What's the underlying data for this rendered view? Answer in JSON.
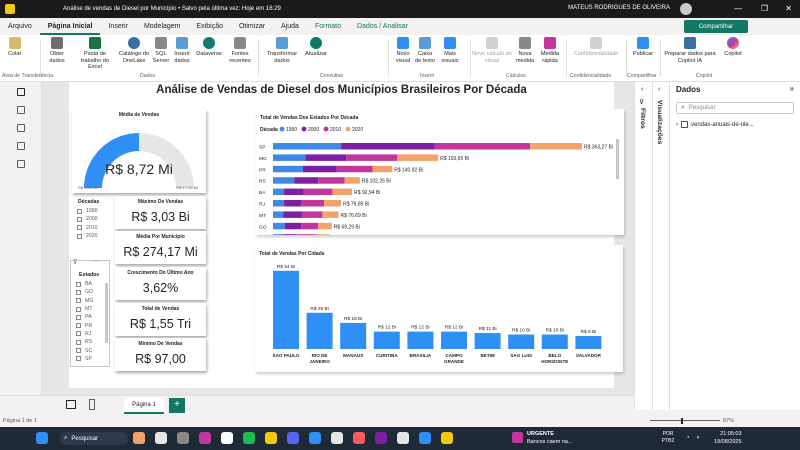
{
  "window": {
    "title": "Análise de vendas de Diesel por Município • Salvo pela última vez: Hoje em 16:29",
    "user": "MATEUS RODRIGUES DE OLIVEIRA"
  },
  "tabs": [
    {
      "label": "Arquivo"
    },
    {
      "label": "Página Inicial"
    },
    {
      "label": "Inserir"
    },
    {
      "label": "Modelagem"
    },
    {
      "label": "Exibição"
    },
    {
      "label": "Otimizar"
    },
    {
      "label": "Ajuda"
    },
    {
      "label": "Formato"
    },
    {
      "label": "Dados / Analisar"
    }
  ],
  "share_label": "Compartilhar",
  "ribbon": {
    "buttons": [
      {
        "label": "Colar",
        "disabled": false
      },
      {
        "label": "Obter dados",
        "disabled": false
      },
      {
        "label": "Pasta de trabalho do Excel",
        "disabled": false
      },
      {
        "label": "Catálogo do OneLake",
        "disabled": false
      },
      {
        "label": "SQL Server",
        "disabled": false
      },
      {
        "label": "Inserir dados",
        "disabled": false
      },
      {
        "label": "Dataverse",
        "disabled": false
      },
      {
        "label": "Fontes recentes",
        "disabled": false
      },
      {
        "label": "Transformar dados",
        "disabled": false
      },
      {
        "label": "Atualizar",
        "disabled": false
      },
      {
        "label": "Novo visual",
        "disabled": false
      },
      {
        "label": "Caixa de texto",
        "disabled": false
      },
      {
        "label": "Mais visuais",
        "disabled": false
      },
      {
        "label": "Nova medida",
        "disabled": false
      },
      {
        "label": "Medida rápida",
        "disabled": false
      },
      {
        "label": "Publicar",
        "disabled": false
      },
      {
        "label": "Preparar dados para Copilot IA",
        "disabled": false
      },
      {
        "label": "Copilot",
        "disabled": false
      },
      {
        "label": "Novo cálculo do visual",
        "disabled": true
      },
      {
        "label": "Confidencialidade",
        "disabled": true
      }
    ],
    "groups": [
      "Área de Transferência",
      "Dados",
      "Consultas",
      "Inserir",
      "Cálculos",
      "Confidencialidade",
      "Compartilhar",
      "Copilot"
    ]
  },
  "report": {
    "title": "Análise de Vendas de Diesel dos Municípios Brasileiros Por Década",
    "gauge": {
      "title": "Média de Vendas",
      "value": "R$ 8,72 Mi",
      "min_label": "R$ 0,00 Mi",
      "max_label": "R$ 17,43 Mi",
      "fill_fraction": 0.5
    },
    "kpis": [
      {
        "title": "Máximo De Vendas",
        "value": "R$ 3,03 Bi"
      },
      {
        "title": "Média Por Município",
        "value": "R$ 274,17 Mi"
      },
      {
        "title": "Crescimento Do Último Ano",
        "value": "3,62%"
      },
      {
        "title": "Total de Vendas",
        "value": "R$ 1,55 Tri"
      },
      {
        "title": "Mínimo De Vendas",
        "value": "R$ 97,00"
      }
    ],
    "slicer_decadas": {
      "title": "Décadas",
      "items": [
        "1990",
        "2000",
        "2010",
        "2020"
      ]
    },
    "slicer_estados": {
      "title": "Estados",
      "items": [
        "BA",
        "GO",
        "MG",
        "MT",
        "PA",
        "PR",
        "RJ",
        "RS",
        "SC",
        "SP"
      ]
    }
  },
  "chart_data": [
    {
      "type": "bar",
      "orientation": "horizontal",
      "stacked": true,
      "title": "Total de Vendas Dos Estados Por Década",
      "legend_title": "Década",
      "legend_position": "top-left",
      "categories": [
        "SP",
        "MG",
        "PR",
        "RS",
        "BA",
        "RJ",
        "MT",
        "GO",
        "SC",
        "PA"
      ],
      "series": [
        {
          "name": "1990",
          "color": "#3f89e6",
          "values": [
            80,
            38,
            35,
            25,
            13,
            13,
            12,
            14,
            11,
            9
          ]
        },
        {
          "name": "2000",
          "color": "#7d1fa3",
          "values": [
            110,
            48,
            40,
            28,
            23,
            20,
            22,
            19,
            18,
            15
          ]
        },
        {
          "name": "2010",
          "color": "#c2379e",
          "values": [
            112,
            60,
            42,
            31,
            34,
            27,
            24,
            20,
            22,
            18
          ]
        },
        {
          "name": "2020",
          "color": "#f2a26a",
          "values": [
            61,
            48,
            23,
            18,
            23,
            20,
            19,
            16,
            16,
            13
          ]
        }
      ],
      "totals": [
        363.27,
        193.65,
        140.92,
        102.25,
        92.94,
        79.89,
        76.69,
        69.29,
        67.11,
        55.41
      ],
      "data_labels": [
        "R$ 363,27 Bi",
        "R$ 193,65 Bi",
        "R$ 140,92 Bi",
        "R$ 102,25 Bi",
        "R$ 92,94 Bi",
        "R$ 79,89 Bi",
        "R$ 76,69 Bi",
        "R$ 69,29 Bi",
        "R$ 67,11 Bi",
        "R$ 55,41 Bi"
      ],
      "xlim": [
        0,
        370
      ]
    },
    {
      "type": "bar",
      "orientation": "vertical",
      "title": "Total de Vendas Por Cidade",
      "categories": [
        "SAO PAULO",
        "RIO DE JANEIRO",
        "MANAUS",
        "CURITIBA",
        "BRASILIA",
        "CAMPO GRANDE",
        "BETIM",
        "SAO LUIS",
        "BELO HORIZONTE",
        "SALVADOR"
      ],
      "values": [
        54,
        25,
        18,
        12,
        12,
        12,
        11,
        10,
        10,
        9
      ],
      "data_labels": [
        "R$ 54 Bi",
        "R$ 25 Bi",
        "R$ 18 Bi",
        "R$ 12 Bi",
        "R$ 12 Bi",
        "R$ 12 Bi",
        "R$ 11 Bi",
        "R$ 10 Bi",
        "R$ 10 Bi",
        "R$ 9 Bi"
      ],
      "color": "#2f8ff5",
      "ylim": [
        0,
        58
      ]
    }
  ],
  "panes": {
    "filters": "Filtros",
    "visualizations": "Visualizações",
    "data": {
      "title": "Dados",
      "search_placeholder": "Pesquisar",
      "table": "vendas-anuais-de-ole..."
    }
  },
  "page": {
    "tab": "Página 1",
    "status": "Página 1 de 1",
    "zoom": "87%"
  },
  "taskbar": {
    "search": "Pesquisar",
    "notification_title": "URGENTE",
    "notification_text": "Bancos caem na...",
    "lang": "POR PTB2",
    "time": "21:05:03",
    "date": "19/08/2025"
  },
  "colors": {
    "accent": "#117865",
    "bar": "#2f8ff5"
  }
}
